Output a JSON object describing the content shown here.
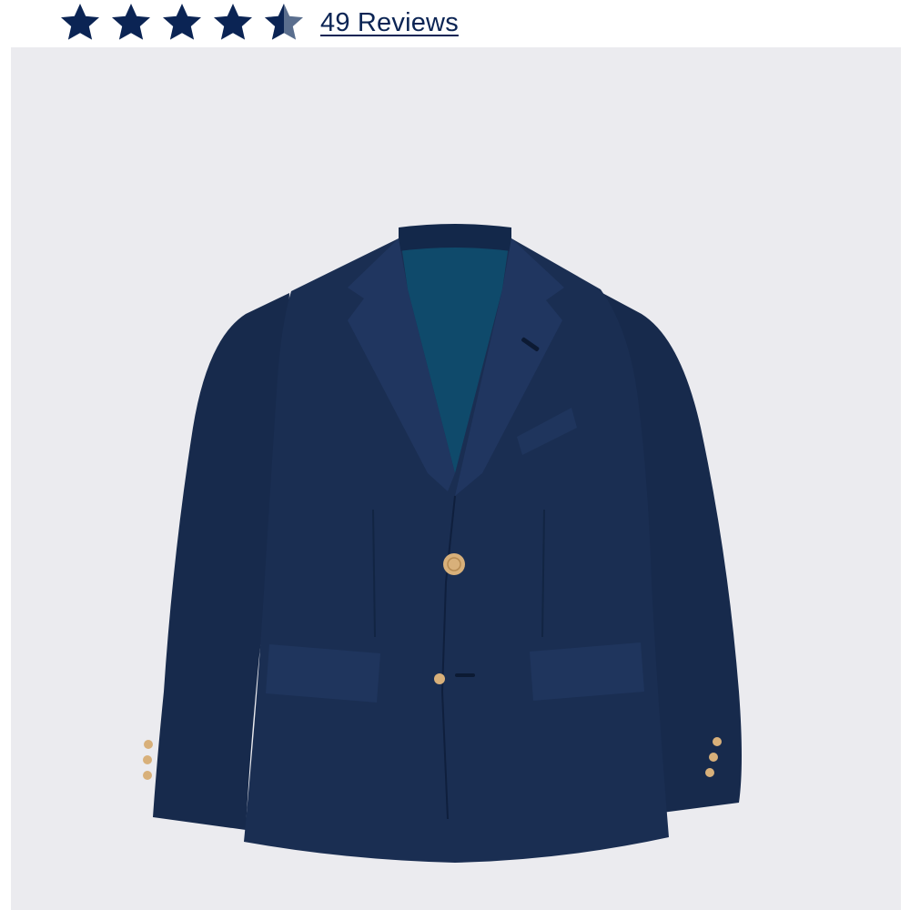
{
  "rating": {
    "value": 4.5,
    "max": 5,
    "star_color": "#0b2454",
    "star_empty_color": "#c9ced8",
    "icon": "star-icon"
  },
  "reviews": {
    "label": "49 Reviews"
  },
  "product": {
    "image_icon": "navy-blazer-image",
    "colors": {
      "fabric": "#1a2e52",
      "lining": "#0f4a6b",
      "button": "#d8b07a",
      "background": "#ebebef"
    }
  }
}
